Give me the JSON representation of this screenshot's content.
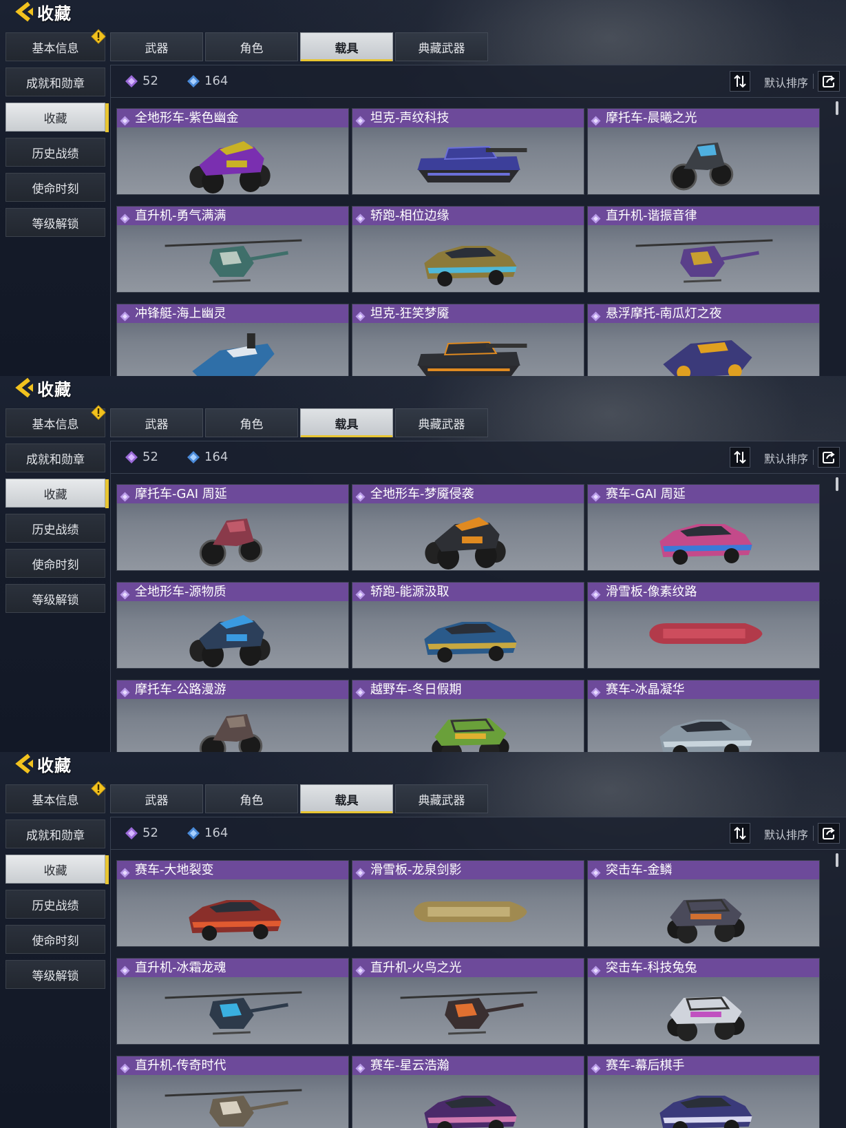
{
  "screen": {
    "title": "收藏",
    "sidebar": [
      "基本信息",
      "成就和勋章",
      "收藏",
      "历史战绩",
      "使命时刻",
      "等级解锁"
    ],
    "sidebar_active": "收藏",
    "tabs": [
      "武器",
      "角色",
      "载具",
      "典藏武器"
    ],
    "tabs_active": "载具",
    "stats": {
      "purple_count": "52",
      "blue_count": "164"
    },
    "sort_label": "默认排序",
    "colors": {
      "accent": "#e8c531",
      "title_bar": "#6d4a9a"
    }
  },
  "panels": [
    {
      "cards": [
        {
          "label": "全地形车-紫色幽金",
          "kind": "atv",
          "main": "#7a2fb0",
          "accent": "#c9b225"
        },
        {
          "label": "坦克-声纹科技",
          "kind": "tank",
          "main": "#3c3f9a",
          "accent": "#6b6fd8"
        },
        {
          "label": "摩托车-晨曦之光",
          "kind": "moto",
          "main": "#3b3f45",
          "accent": "#4fb0e0"
        },
        {
          "label": "直升机-勇气满满",
          "kind": "heli",
          "main": "#3f6f6a",
          "accent": "#b9c9c0"
        },
        {
          "label": "轿跑-相位边缘",
          "kind": "car",
          "main": "#8c7a3a",
          "accent": "#4fb8d8"
        },
        {
          "label": "直升机-谐振音律",
          "kind": "heli",
          "main": "#5a3f8a",
          "accent": "#c9a030"
        },
        {
          "label": "冲锋艇-海上幽灵",
          "kind": "boat",
          "main": "#2f6fa8",
          "accent": "#dfe6ee"
        },
        {
          "label": "坦克-狂笑梦魇",
          "kind": "tank",
          "main": "#2d2f34",
          "accent": "#e08a20"
        },
        {
          "label": "悬浮摩托-南瓜灯之夜",
          "kind": "hover",
          "main": "#3b3a7a",
          "accent": "#e0a020"
        }
      ]
    },
    {
      "cards": [
        {
          "label": "摩托车-GAI 周延",
          "kind": "moto",
          "main": "#8a3a4a",
          "accent": "#c05a6a"
        },
        {
          "label": "全地形车-梦魇侵袭",
          "kind": "atv",
          "main": "#2d2f34",
          "accent": "#e08a20"
        },
        {
          "label": "赛车-GAI 周延",
          "kind": "car",
          "main": "#c44a8a",
          "accent": "#3a7ad8"
        },
        {
          "label": "全地形车-源物质",
          "kind": "atv",
          "main": "#2c3f5a",
          "accent": "#3a9ae0"
        },
        {
          "label": "轿跑-能源汲取",
          "kind": "car",
          "main": "#2a5a8a",
          "accent": "#c8a840"
        },
        {
          "label": "滑雪板-像素纹路",
          "kind": "board",
          "main": "#b23a4a",
          "accent": "#e05a6a"
        },
        {
          "label": "摩托车-公路漫游",
          "kind": "moto",
          "main": "#5a4a48",
          "accent": "#8a7a70"
        },
        {
          "label": "越野车-冬日假期",
          "kind": "buggy",
          "main": "#6aa03a",
          "accent": "#e0b030"
        },
        {
          "label": "赛车-冰晶凝华",
          "kind": "car",
          "main": "#8a98a4",
          "accent": "#c8d4dc"
        }
      ]
    },
    {
      "cards": [
        {
          "label": "赛车-大地裂变",
          "kind": "car",
          "main": "#8a2f2a",
          "accent": "#e05a30"
        },
        {
          "label": "滑雪板-龙泉剑影",
          "kind": "board",
          "main": "#a08a50",
          "accent": "#d8c890"
        },
        {
          "label": "突击车-金鳞",
          "kind": "buggy",
          "main": "#4a4a5a",
          "accent": "#d07030"
        },
        {
          "label": "直升机-冰霜龙魂",
          "kind": "heli",
          "main": "#2d3a4a",
          "accent": "#3ab0e0"
        },
        {
          "label": "直升机-火鸟之光",
          "kind": "heli",
          "main": "#3a2f30",
          "accent": "#e07030"
        },
        {
          "label": "突击车-科技兔兔",
          "kind": "buggy",
          "main": "#d0d4dc",
          "accent": "#c050c0"
        },
        {
          "label": "直升机-传奇时代",
          "kind": "heli",
          "main": "#6a6050",
          "accent": "#d8d0c0"
        },
        {
          "label": "赛车-星云浩瀚",
          "kind": "car",
          "main": "#4a2a6a",
          "accent": "#d07ab0"
        },
        {
          "label": "赛车-幕后棋手",
          "kind": "car",
          "main": "#3a3a7a",
          "accent": "#d8d8f0"
        }
      ]
    }
  ]
}
